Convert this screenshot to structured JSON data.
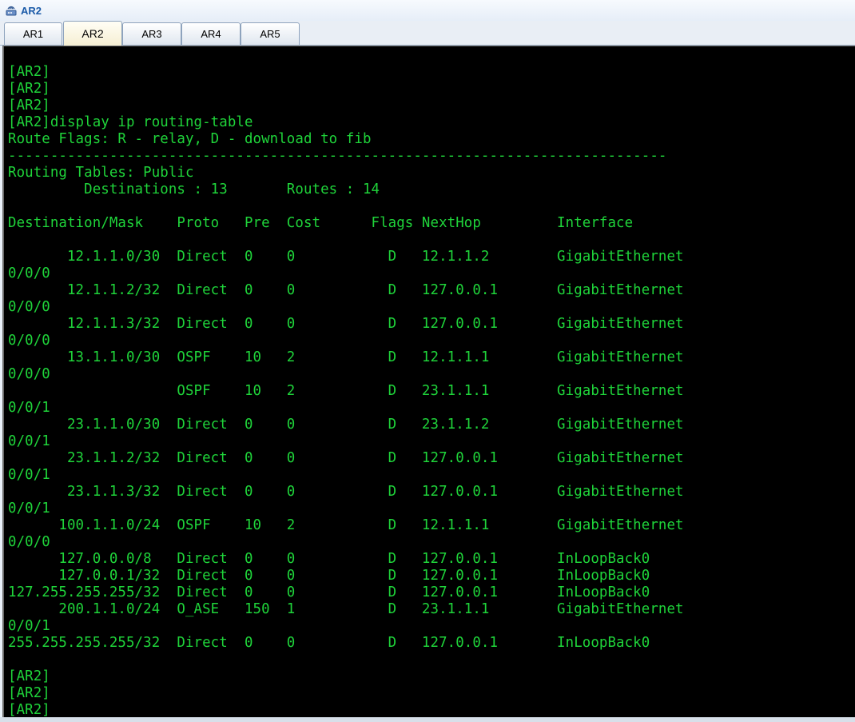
{
  "window": {
    "title": "AR2"
  },
  "tabs": [
    {
      "label": "AR1"
    },
    {
      "label": "AR2"
    },
    {
      "label": "AR3"
    },
    {
      "label": "AR4"
    },
    {
      "label": "AR5"
    }
  ],
  "terminal": {
    "lines": [
      "[AR2]",
      "[AR2]",
      "[AR2]",
      "[AR2]display ip routing-table",
      "Route Flags: R - relay, D - download to fib",
      "------------------------------------------------------------------------------",
      "Routing Tables: Public",
      "         Destinations : 13       Routes : 14",
      "",
      "Destination/Mask    Proto   Pre  Cost      Flags NextHop         Interface",
      "",
      "       12.1.1.0/30  Direct  0    0           D   12.1.1.2        GigabitEthernet",
      "0/0/0",
      "       12.1.1.2/32  Direct  0    0           D   127.0.0.1       GigabitEthernet",
      "0/0/0",
      "       12.1.1.3/32  Direct  0    0           D   127.0.0.1       GigabitEthernet",
      "0/0/0",
      "       13.1.1.0/30  OSPF    10   2           D   12.1.1.1        GigabitEthernet",
      "0/0/0",
      "                    OSPF    10   2           D   23.1.1.1        GigabitEthernet",
      "0/0/1",
      "       23.1.1.0/30  Direct  0    0           D   23.1.1.2        GigabitEthernet",
      "0/0/1",
      "       23.1.1.2/32  Direct  0    0           D   127.0.0.1       GigabitEthernet",
      "0/0/1",
      "       23.1.1.3/32  Direct  0    0           D   127.0.0.1       GigabitEthernet",
      "0/0/1",
      "      100.1.1.0/24  OSPF    10   2           D   12.1.1.1        GigabitEthernet",
      "0/0/0",
      "      127.0.0.0/8   Direct  0    0           D   127.0.0.1       InLoopBack0",
      "      127.0.0.1/32  Direct  0    0           D   127.0.0.1       InLoopBack0",
      "127.255.255.255/32  Direct  0    0           D   127.0.0.1       InLoopBack0",
      "      200.1.1.0/24  O_ASE   150  1           D   23.1.1.1        GigabitEthernet",
      "0/0/1",
      "255.255.255.255/32  Direct  0    0           D   127.0.0.1       InLoopBack0",
      "",
      "[AR2]",
      "[AR2]",
      "[AR2]"
    ]
  },
  "colors": {
    "terminal_bg": "#000000",
    "terminal_fg": "#1fd43a",
    "title": "#1a5aa8"
  },
  "icons": {
    "app": "router-icon"
  }
}
